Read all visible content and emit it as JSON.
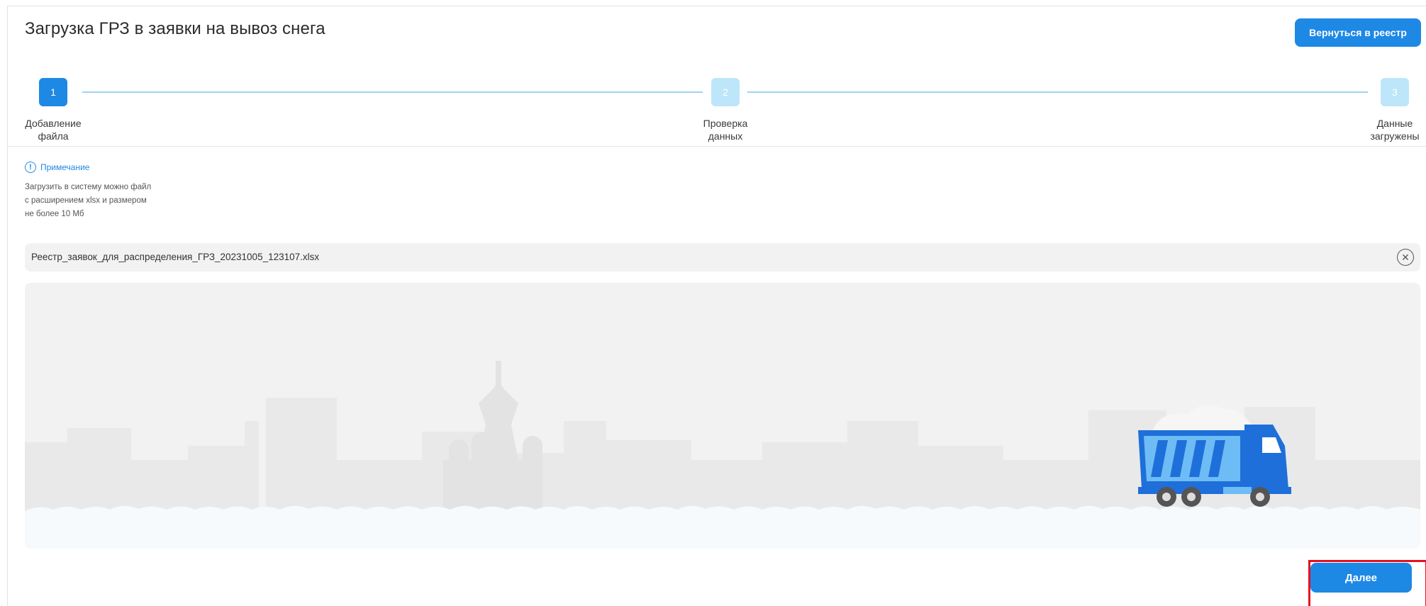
{
  "header": {
    "title": "Загрузка ГРЗ в заявки на вывоз снега",
    "back_button_label": "Вернуться в реестр"
  },
  "stepper": {
    "steps": [
      {
        "number": "1",
        "label": "Добавление\nфайла",
        "state": "active"
      },
      {
        "number": "2",
        "label": "Проверка\nданных",
        "state": "pending"
      },
      {
        "number": "3",
        "label": "Данные\nзагружены",
        "state": "pending"
      }
    ]
  },
  "note": {
    "icon": "info-icon",
    "title": "Примечание",
    "text": "Загрузить в систему можно файл с расширением xlsx и размером не более 10 Мб"
  },
  "file": {
    "name": "Реестр_заявок_для_распределения_ГРЗ_20231005_123107.xlsx",
    "remove_icon": "close-circle-icon"
  },
  "footer": {
    "next_button_label": "Далее"
  },
  "colors": {
    "primary": "#1e88e5",
    "step_pending": "#bde6fa",
    "step_line": "#9fd4ee",
    "highlight": "#e8101e",
    "panel": "#f2f2f2"
  }
}
